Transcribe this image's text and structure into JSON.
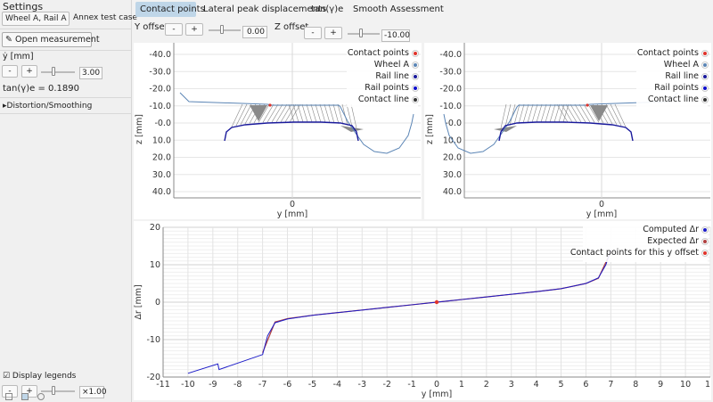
{
  "sidebar": {
    "title": "Settings",
    "case_dropdown": "Wheel A, Rail A ▾",
    "annex_label": "Annex test case",
    "open_button": "✎ Open measurement",
    "ydot_label": "ẏ [mm]",
    "ydot_minus": "-",
    "ydot_plus": "+",
    "ydot_value": "3.00",
    "tan_label": "tan(γ)e = 0.1890",
    "distortion_label": "▸Distortion/Smoothing",
    "display_legends": "☑ Display legends",
    "scale_minus": "-",
    "scale_plus": "+",
    "scale_value": "×1.00"
  },
  "tabs": [
    "Contact points",
    "Lateral peak displacements",
    "tan(γ)e",
    "Smooth Assessment"
  ],
  "offsets": {
    "y_label": "Y offset",
    "y_minus": "-",
    "y_plus": "+",
    "y_value": "0.00",
    "z_label": "Z offset",
    "z_minus": "-",
    "z_plus": "+",
    "z_value": "-10.00"
  },
  "colors": {
    "contact_points": "#e0332b",
    "wheel": "#5b85b5",
    "rail_line": "#1a1a9c",
    "rail_points": "#0d0dcc",
    "contact_line": "#333333",
    "computed": "#1c1cc8",
    "expected": "#b04040",
    "active_tab": "#bfd6e8"
  },
  "legends": {
    "profile": [
      "Contact points",
      "Wheel A",
      "Rail line",
      "Rail points",
      "Contact line"
    ],
    "delta_r": [
      "Computed Δr",
      "Expected Δr",
      "Contact points for this y offset"
    ]
  },
  "chart_data": [
    {
      "type": "line",
      "title": "",
      "xlabel": "y [mm]",
      "ylabel": "z [mm]",
      "xticks": [
        "0"
      ],
      "yticks": [
        "-40.0",
        "-30.0",
        "-20.0",
        "-10.0",
        "-0.0",
        "10.0",
        "20.0",
        "30.0",
        "40.0"
      ],
      "ylim": [
        40,
        -40
      ],
      "series": [
        {
          "name": "Wheel A"
        },
        {
          "name": "Rail line"
        },
        {
          "name": "Contact line"
        }
      ]
    },
    {
      "type": "line",
      "title": "",
      "xlabel": "y [mm]",
      "ylabel": "z [mm]",
      "xticks": [
        "0"
      ],
      "yticks": [
        "-40.0",
        "-30.0",
        "-20.0",
        "-10.0",
        "-0.0",
        "10.0",
        "20.0",
        "30.0",
        "40.0"
      ],
      "ylim": [
        40,
        -40
      ],
      "series": [
        {
          "name": "Wheel A"
        },
        {
          "name": "Rail line"
        },
        {
          "name": "Contact line"
        }
      ]
    },
    {
      "type": "line",
      "title": "",
      "xlabel": "y [mm]",
      "ylabel": "Δr [mm]",
      "xlim": [
        -11,
        11
      ],
      "ylim": [
        -20,
        20
      ],
      "xticks": [
        -11,
        -10,
        -9,
        -8,
        -7,
        -6,
        -5,
        -4,
        -3,
        -2,
        -1,
        0,
        1,
        2,
        3,
        4,
        5,
        6,
        7,
        8,
        9,
        10,
        11
      ],
      "yticks": [
        20,
        10,
        0,
        -10,
        -20
      ],
      "series": [
        {
          "name": "Computed Δr",
          "x": [
            -10.0,
            -8.8,
            -8.75,
            -7.0,
            -6.8,
            -6.5,
            -6.0,
            -5.0,
            -4.0,
            -3.0,
            -2.0,
            -1.0,
            0.0,
            1.0,
            2.0,
            3.0,
            4.0,
            5.0,
            6.0,
            6.5,
            6.8,
            7.0
          ],
          "y": [
            -19.0,
            -16.5,
            -18.0,
            -14.0,
            -9.0,
            -5.5,
            -4.5,
            -3.5,
            -2.8,
            -2.1,
            -1.4,
            -0.7,
            0.0,
            0.7,
            1.4,
            2.1,
            2.8,
            3.6,
            5.0,
            6.5,
            10.0,
            14.0
          ]
        },
        {
          "name": "Expected Δr",
          "x": [
            -7.0,
            -6.5,
            -6.0,
            -5.0,
            -4.0,
            -3.0,
            -2.0,
            -1.0,
            0.0,
            1.0,
            2.0,
            3.0,
            4.0,
            5.0,
            6.0,
            6.5,
            7.0
          ],
          "y": [
            -13.5,
            -5.3,
            -4.4,
            -3.5,
            -2.8,
            -2.1,
            -1.4,
            -0.7,
            0.0,
            0.7,
            1.4,
            2.1,
            2.8,
            3.6,
            5.0,
            6.4,
            13.5
          ]
        },
        {
          "name": "Contact points for this y offset",
          "x": [
            0.0
          ],
          "y": [
            0.0
          ]
        }
      ]
    }
  ]
}
